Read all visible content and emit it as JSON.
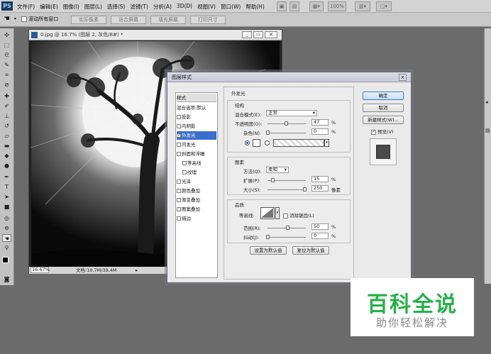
{
  "menubar": {
    "logo": "PS",
    "items": [
      "文件(F)",
      "编辑(E)",
      "图像(I)",
      "图层(L)",
      "选择(S)",
      "滤镜(T)",
      "分析(A)",
      "3D(D)",
      "视图(V)",
      "窗口(W)",
      "帮助(H)"
    ],
    "zoom": "100%"
  },
  "options": {
    "scroll_all": "滚动所有窗口",
    "buttons": [
      "实际像素",
      "适合屏幕",
      "填充屏幕",
      "打印尺寸"
    ]
  },
  "document": {
    "title": "0.jpg @ 16.7% (图层 2, 灰色/8#) *",
    "zoom": "16.67%",
    "doc_size": "文档:10.7M/39.4M"
  },
  "dialog": {
    "title": "图层样式",
    "close": "x",
    "styles_header": "样式",
    "blend_options": "混合选项:默认",
    "styles": [
      {
        "label": "投影",
        "checked": false
      },
      {
        "label": "内阴影",
        "checked": false
      },
      {
        "label": "外发光",
        "checked": true
      },
      {
        "label": "内发光",
        "checked": false
      },
      {
        "label": "斜面和浮雕",
        "checked": false
      },
      {
        "label": "等高线",
        "checked": false
      },
      {
        "label": "纹理",
        "checked": false
      },
      {
        "label": "光泽",
        "checked": false
      },
      {
        "label": "颜色叠加",
        "checked": false
      },
      {
        "label": "渐变叠加",
        "checked": false
      },
      {
        "label": "图案叠加",
        "checked": false
      },
      {
        "label": "描边",
        "checked": false
      }
    ],
    "panel_title": "外发光",
    "structure": {
      "title": "结构",
      "blend_mode_label": "混合模式(E):",
      "blend_mode": "正常",
      "opacity_label": "不透明度(O):",
      "opacity": "47",
      "noise_label": "杂色(N):",
      "noise": "0",
      "percent": "%"
    },
    "elements": {
      "title": "图素",
      "technique_label": "方法(Q):",
      "technique": "柔和",
      "spread_label": "扩展(P):",
      "spread": "15",
      "size_label": "大小(S):",
      "size": "250",
      "percent": "%",
      "px": "像素"
    },
    "quality": {
      "title": "品质",
      "contour_label": "等高线:",
      "antialias": "消除锯齿(L)",
      "range_label": "范围(R):",
      "range": "50",
      "jitter_label": "抖动(J):",
      "jitter": "0",
      "percent": "%"
    },
    "make_default": "设置为默认值",
    "reset_default": "复位为默认值",
    "ok": "确定",
    "cancel": "取消",
    "new_style": "新建样式(W)...",
    "preview_label": "预览(V)"
  },
  "watermark": {
    "title": "百科全说",
    "subtitle": "助你轻松解决"
  }
}
